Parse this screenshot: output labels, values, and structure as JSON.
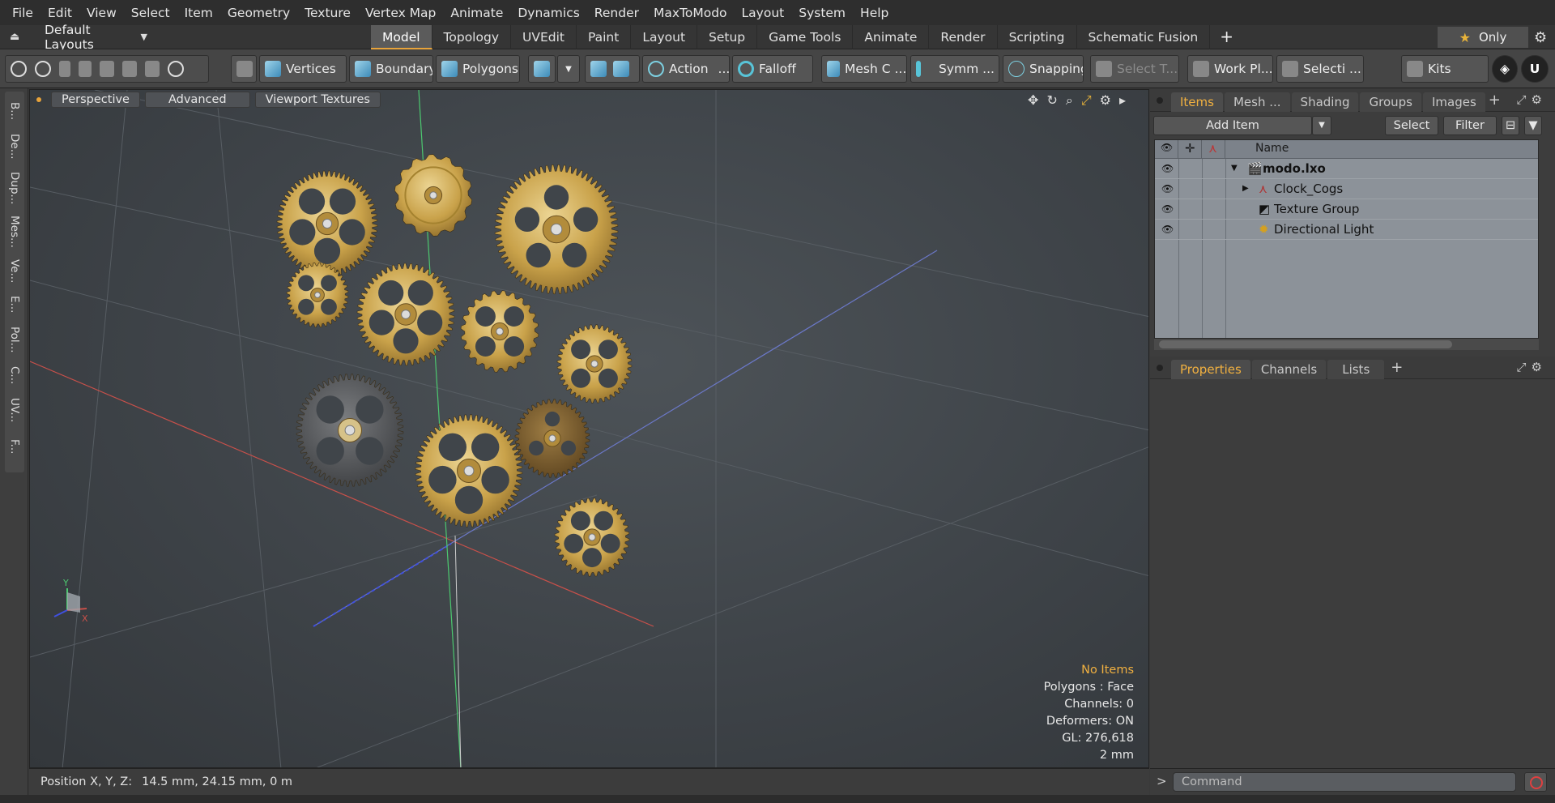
{
  "menu": [
    "File",
    "Edit",
    "View",
    "Select",
    "Item",
    "Geometry",
    "Texture",
    "Vertex Map",
    "Animate",
    "Dynamics",
    "Render",
    "MaxToModo",
    "Layout",
    "System",
    "Help"
  ],
  "layout_dropdown": "Default Layouts",
  "mode_tabs": [
    "Model",
    "Topology",
    "UVEdit",
    "Paint",
    "Layout",
    "Setup",
    "Game Tools",
    "Animate",
    "Render",
    "Scripting",
    "Schematic Fusion"
  ],
  "active_tab": "Model",
  "only_label": "Only",
  "toolbar": {
    "vertices": "Vertices",
    "boundary": "Boundary",
    "polygons": "Polygons",
    "action": "Action",
    "falloff": "Falloff",
    "mesh_c": "Mesh C ...",
    "symm": "Symm ...",
    "snapping": "Snapping",
    "select_t": "Select T...",
    "work_pl": "Work Pl...",
    "selecti": "Selecti ...",
    "kits": "Kits"
  },
  "left_tabs": [
    "B...",
    "De...",
    "Dup...",
    "Mes...",
    "Ve...",
    "E...",
    "Pol...",
    "C...",
    "UV...",
    "F..."
  ],
  "viewport": {
    "buttons": [
      "Perspective",
      "Advanced",
      "Viewport Textures"
    ],
    "stats": {
      "selection": "No Items",
      "polygons": "Polygons : Face",
      "channels": "Channels: 0",
      "deformers": "Deformers: ON",
      "gl": "GL: 276,618",
      "scale": "2 mm"
    },
    "axis_y": "Y",
    "axis_x": "X"
  },
  "status": {
    "label": "Position X, Y, Z:",
    "value": "14.5 mm, 24.15 mm, 0 m"
  },
  "items_panel": {
    "tabs": [
      "Items",
      "Mesh ...",
      "Shading",
      "Groups",
      "Images"
    ],
    "add_item": "Add Item",
    "select": "Select",
    "filter": "Filter",
    "name_col": "Name",
    "tree": [
      "modo.lxo",
      "Clock_Cogs",
      "Texture Group",
      "Directional Light"
    ]
  },
  "props_panel": {
    "tabs": [
      "Properties",
      "Channels",
      "Lists"
    ]
  },
  "command_placeholder": "Command",
  "colors": {
    "accent": "#e8a33a",
    "gear_gold": "#c9a24a",
    "gear_dark": "#55575a"
  }
}
